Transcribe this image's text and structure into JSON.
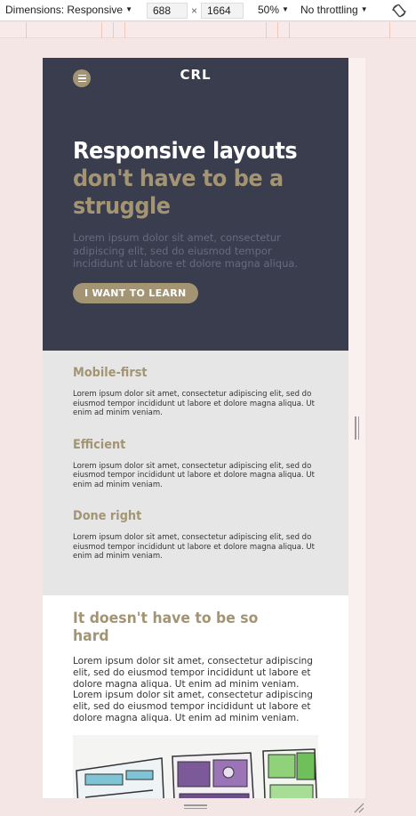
{
  "devtools": {
    "dimensions_label": "Dimensions: Responsive",
    "width_value": "688",
    "times": "×",
    "height_value": "1664",
    "zoom": "50%",
    "throttling": "No throttling",
    "rotate_icon": "rotate-icon"
  },
  "site": {
    "logo": "CRL",
    "menu_icon": "hamburger-icon",
    "hero": {
      "title_line1": "Responsive layouts",
      "title_line2": "don't have to be a",
      "title_line3": "struggle",
      "body": "Lorem ipsum dolor sit amet, consectetur adipiscing elit, sed do eiusmod tempor incididunt ut labore et dolore magna aliqua.",
      "cta": "I WANT TO LEARN"
    },
    "features": [
      {
        "title": "Mobile-first",
        "body": "Lorem ipsum dolor sit amet, consectetur adipiscing elit, sed do eiusmod tempor incididunt ut labore et dolore magna aliqua. Ut enim ad minim veniam."
      },
      {
        "title": "Efficient",
        "body": "Lorem ipsum dolor sit amet, consectetur adipiscing elit, sed do eiusmod tempor incididunt ut labore et dolore magna aliqua. Ut enim ad minim veniam."
      },
      {
        "title": "Done right",
        "body": "Lorem ipsum dolor sit amet, consectetur adipiscing elit, sed do eiusmod tempor incididunt ut labore et dolore magna aliqua. Ut enim ad minim veniam."
      }
    ],
    "content": {
      "heading": "It doesn't have to be so hard",
      "body": "Lorem ipsum dolor sit amet, consectetur adipiscing elit, sed do eiusmod tempor incididunt ut labore et dolore magna aliqua. Ut enim ad minim veniam. Lorem ipsum dolor sit amet, consectetur adipiscing elit, sed do eiusmod tempor incididunt ut labore et dolore magna aliqua. Ut enim ad minim veniam."
    }
  },
  "colors": {
    "dark": "#3a3d4d",
    "accent": "#a39474",
    "features_bg": "#e6e6e6"
  }
}
